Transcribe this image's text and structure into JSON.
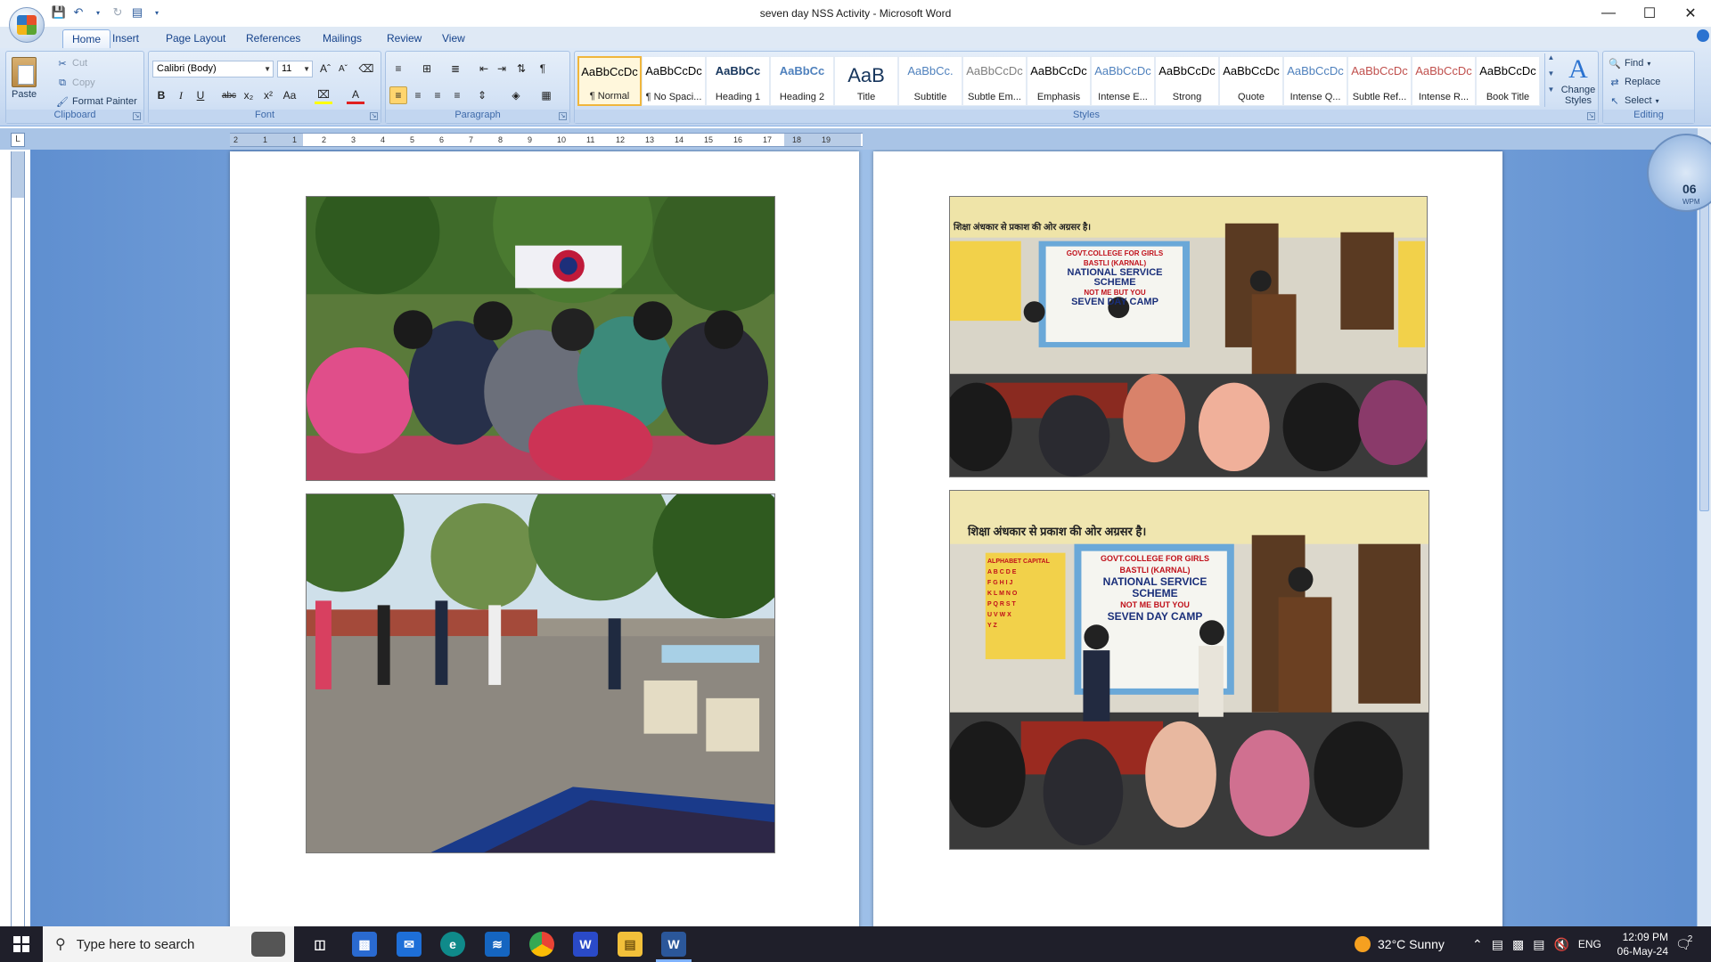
{
  "window": {
    "title": "seven day NSS Activity - Microsoft Word",
    "minimize": "—",
    "maximize": "☐",
    "close": "✕"
  },
  "tabs": [
    "Home",
    "Insert",
    "Page Layout",
    "References",
    "Mailings",
    "Review",
    "View"
  ],
  "ribbon": {
    "clipboard": {
      "label": "Clipboard",
      "paste": "Paste",
      "cut": "Cut",
      "copy": "Copy",
      "format_painter": "Format Painter"
    },
    "font": {
      "label": "Font",
      "family": "Calibri (Body)",
      "size": "11"
    },
    "paragraph": {
      "label": "Paragraph"
    },
    "styles": {
      "label": "Styles",
      "items": [
        {
          "sample": "AaBbCcDc",
          "name": "¶ Normal",
          "color": "#000000"
        },
        {
          "sample": "AaBbCcDc",
          "name": "¶ No Spaci...",
          "color": "#000000"
        },
        {
          "sample": "AaBbCc",
          "name": "Heading 1",
          "color": "#17365d"
        },
        {
          "sample": "AaBbCc",
          "name": "Heading 2",
          "color": "#4f81bd"
        },
        {
          "sample": "AaB",
          "name": "Title",
          "color": "#17365d"
        },
        {
          "sample": "AaBbCc.",
          "name": "Subtitle",
          "color": "#4f81bd"
        },
        {
          "sample": "AaBbCcDc",
          "name": "Subtle Em...",
          "color": "#7f7f7f"
        },
        {
          "sample": "AaBbCcDc",
          "name": "Emphasis",
          "color": "#000000"
        },
        {
          "sample": "AaBbCcDc",
          "name": "Intense E...",
          "color": "#4f81bd"
        },
        {
          "sample": "AaBbCcDc",
          "name": "Strong",
          "color": "#000000"
        },
        {
          "sample": "AaBbCcDc",
          "name": "Quote",
          "color": "#000000"
        },
        {
          "sample": "AaBbCcDc",
          "name": "Intense Q...",
          "color": "#4f81bd"
        },
        {
          "sample": "AaBbCcDc",
          "name": "Subtle Ref...",
          "color": "#c0504d"
        },
        {
          "sample": "AaBbCcDc",
          "name": "Intense R...",
          "color": "#c0504d"
        },
        {
          "sample": "AaBbCcDc",
          "name": "Book Title",
          "color": "#000000"
        }
      ],
      "change_styles": "Change Styles"
    },
    "editing": {
      "label": "Editing",
      "find": "Find",
      "replace": "Replace",
      "select": "Select"
    }
  },
  "ruler": {
    "marks": [
      "2",
      "1",
      "1",
      "2",
      "3",
      "4",
      "5",
      "6",
      "7",
      "8",
      "9",
      "10",
      "11",
      "12",
      "13",
      "14",
      "15",
      "16",
      "17",
      "18",
      "19"
    ]
  },
  "photos": [
    {
      "id": "pg1-top",
      "scene": "outdoor-gathering"
    },
    {
      "id": "pg1-bottom",
      "scene": "courtyard-activity"
    },
    {
      "id": "pg2-top",
      "scene": "classroom-seminar"
    },
    {
      "id": "pg2-bottom",
      "scene": "classroom-seminar"
    }
  ],
  "banner": {
    "college": "GOVT.COLLEGE FOR GIRLS",
    "place": "BASTLI (KARNAL)",
    "scheme": "NATIONAL SERVICE SCHEME",
    "motto": "NOT ME BUT YOU",
    "camp": "SEVEN DAY CAMP",
    "wall_slogan": "शिक्षा अंधकार से प्रकाश की ओर अग्रसर है।",
    "alphabet_title": "ALPHABET CAPITAL",
    "alphabet_rows": [
      "A B C D E",
      "F G H I J",
      "K L M N O",
      "P Q R S T",
      "U V W X",
      "Y Z"
    ]
  },
  "gauge": {
    "value": "06",
    "unit": "WPM"
  },
  "taskbar": {
    "search_placeholder": "Type here to search",
    "weather": "32°C  Sunny",
    "language": "ENG",
    "time": "12:09 PM",
    "date": "06-May-24",
    "notification_count": "2"
  }
}
